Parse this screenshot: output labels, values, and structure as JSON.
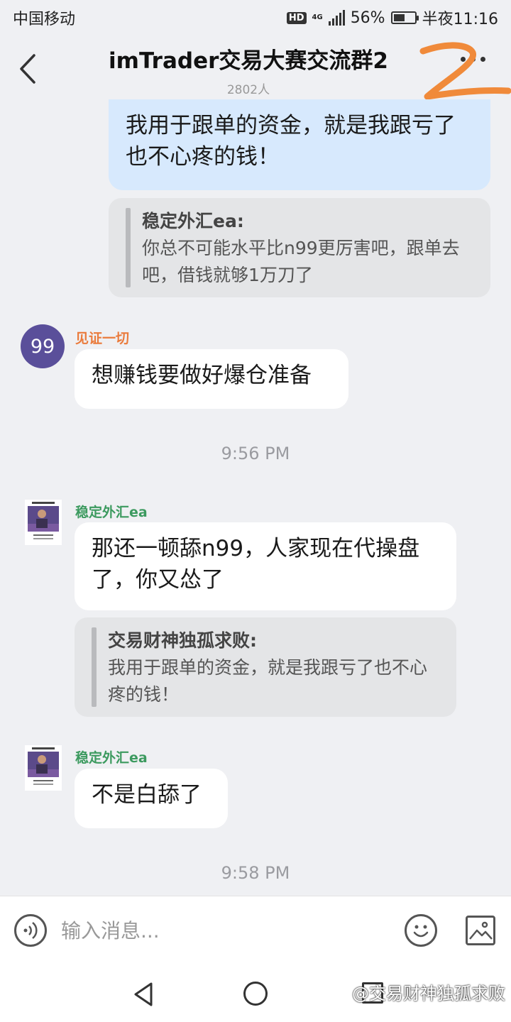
{
  "status_bar": {
    "carrier": "中国移动",
    "hd": "HD",
    "network": "4G",
    "battery": "56%",
    "battery_level": 0.56,
    "time": "半夜11:16"
  },
  "header": {
    "title": "imTrader交易大赛交流群2",
    "member_count": "2802人"
  },
  "messages": [
    {
      "type": "self",
      "text": "我用于跟单的资金，就是我跟亏了也不心疼的钱！"
    },
    {
      "type": "quote",
      "author": "稳定外汇ea:",
      "text": "你总不可能水平比n99更厉害吧，跟单去吧，借钱就够1万刀了"
    },
    {
      "type": "other",
      "sender": "见证一切",
      "sender_color": "#ea7b3c",
      "avatar_text": "99",
      "text": "想赚钱要做好爆仓准备"
    },
    {
      "type": "time",
      "text": "9:56 PM"
    },
    {
      "type": "other",
      "sender": "稳定外汇ea",
      "sender_color": "#3c9a5f",
      "text": "那还一顿舔n99，人家现在代操盘了，你又怂了"
    },
    {
      "type": "quote",
      "author": "交易财神独孤求败:",
      "text": "我用于跟单的资金，就是我跟亏了也不心疼的钱！"
    },
    {
      "type": "other",
      "sender": "稳定外汇ea",
      "sender_color": "#3c9a5f",
      "text": "不是白舔了"
    },
    {
      "type": "time",
      "text": "9:58 PM"
    }
  ],
  "input": {
    "placeholder": "输入消息..."
  },
  "watermark": "@交易财神独孤求败",
  "colors": {
    "self_bubble": "#d7e9fd",
    "avatar_bg": "#5a4f9a",
    "annotation": "#f08a3a"
  }
}
